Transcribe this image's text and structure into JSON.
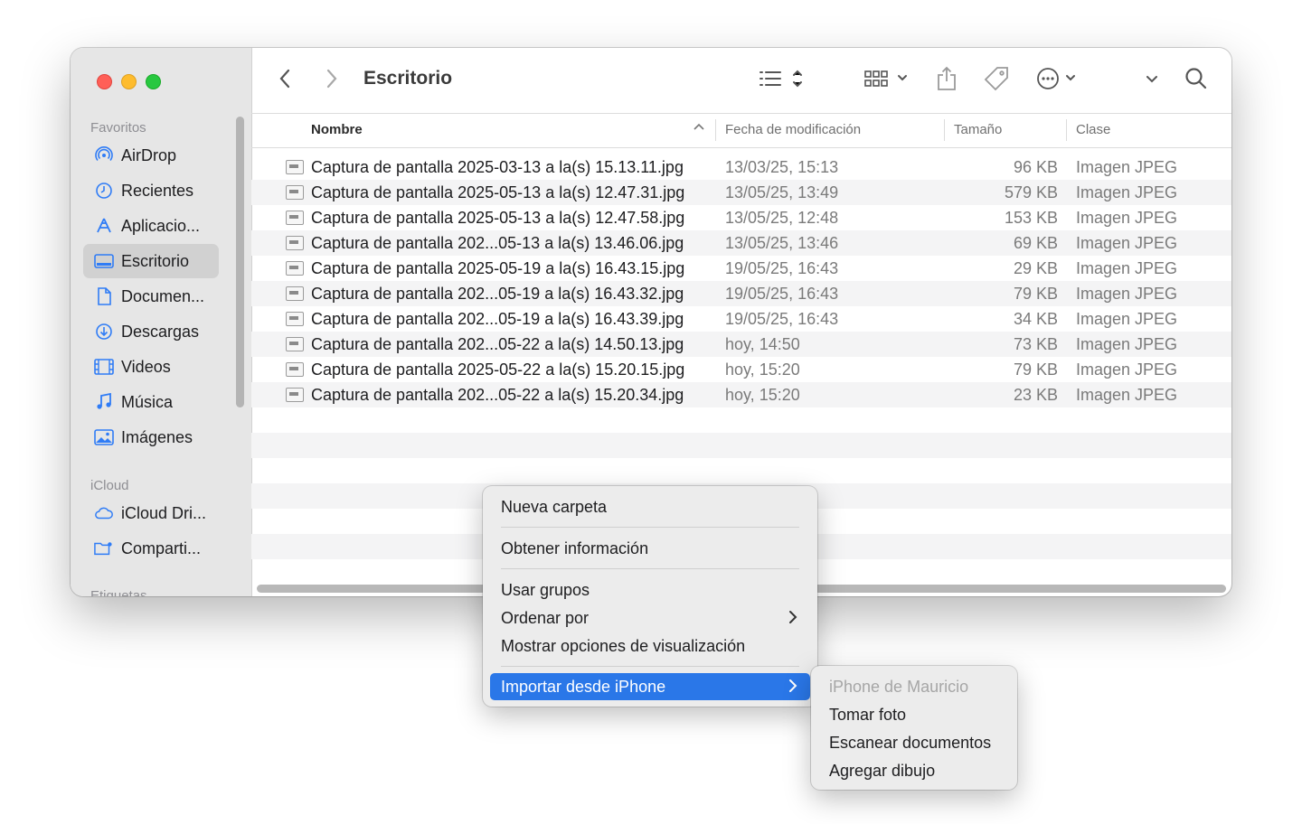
{
  "window": {
    "title": "Escritorio",
    "traffic_colors": {
      "close": "#ff5f57",
      "minimize": "#febc2e",
      "zoom": "#28c840"
    }
  },
  "sidebar": {
    "favorites_label": "Favoritos",
    "favorites": [
      {
        "label": "AirDrop",
        "icon": "airdrop-icon"
      },
      {
        "label": "Recientes",
        "icon": "clock-icon"
      },
      {
        "label": "Aplicacio...",
        "icon": "applications-icon"
      },
      {
        "label": "Escritorio",
        "icon": "desktop-icon",
        "selected": true
      },
      {
        "label": "Documen...",
        "icon": "document-icon"
      },
      {
        "label": "Descargas",
        "icon": "download-icon"
      },
      {
        "label": "Videos",
        "icon": "film-icon"
      },
      {
        "label": "Música",
        "icon": "music-icon"
      },
      {
        "label": "Imágenes",
        "icon": "photo-icon"
      }
    ],
    "icloud_label": "iCloud",
    "icloud": [
      {
        "label": "iCloud Dri...",
        "icon": "cloud-icon"
      },
      {
        "label": "Comparti...",
        "icon": "shared-folder-icon"
      }
    ],
    "tags_label": "Etiquetas"
  },
  "columns": {
    "name": "Nombre",
    "date": "Fecha de modificación",
    "size": "Tamaño",
    "kind": "Clase"
  },
  "files": [
    {
      "name": "Captura de pantalla 2025-03-13 a la(s) 15.13.11.jpg",
      "date": "13/03/25, 15:13",
      "size": "96 KB",
      "kind": "Imagen JPEG"
    },
    {
      "name": "Captura de pantalla 2025-05-13 a la(s) 12.47.31.jpg",
      "date": "13/05/25, 13:49",
      "size": "579 KB",
      "kind": "Imagen JPEG"
    },
    {
      "name": "Captura de pantalla 2025-05-13 a la(s) 12.47.58.jpg",
      "date": "13/05/25, 12:48",
      "size": "153 KB",
      "kind": "Imagen JPEG"
    },
    {
      "name": "Captura de pantalla 202...05-13 a la(s) 13.46.06.jpg",
      "date": "13/05/25, 13:46",
      "size": "69 KB",
      "kind": "Imagen JPEG"
    },
    {
      "name": "Captura de pantalla 2025-05-19 a la(s) 16.43.15.jpg",
      "date": "19/05/25, 16:43",
      "size": "29 KB",
      "kind": "Imagen JPEG"
    },
    {
      "name": "Captura de pantalla 202...05-19 a la(s) 16.43.32.jpg",
      "date": "19/05/25, 16:43",
      "size": "79 KB",
      "kind": "Imagen JPEG"
    },
    {
      "name": "Captura de pantalla 202...05-19 a la(s) 16.43.39.jpg",
      "date": "19/05/25, 16:43",
      "size": "34 KB",
      "kind": "Imagen JPEG"
    },
    {
      "name": "Captura de pantalla 202...05-22 a la(s) 14.50.13.jpg",
      "date": "hoy, 14:50",
      "size": "73 KB",
      "kind": "Imagen JPEG"
    },
    {
      "name": "Captura de pantalla 2025-05-22 a la(s) 15.20.15.jpg",
      "date": "hoy, 15:20",
      "size": "79 KB",
      "kind": "Imagen JPEG"
    },
    {
      "name": "Captura de pantalla 202...05-22 a la(s) 15.20.34.jpg",
      "date": "hoy, 15:20",
      "size": "23 KB",
      "kind": "Imagen JPEG"
    }
  ],
  "context_menu": {
    "new_folder": "Nueva carpeta",
    "get_info": "Obtener información",
    "use_groups": "Usar grupos",
    "sort_by": "Ordenar por",
    "view_options": "Mostrar opciones de visualización",
    "import_iphone": "Importar desde iPhone",
    "accent_color": "#2a77e8"
  },
  "submenu": {
    "device": "iPhone de Mauricio",
    "take_photo": "Tomar foto",
    "scan_documents": "Escanear documentos",
    "add_sketch": "Agregar dibujo"
  }
}
